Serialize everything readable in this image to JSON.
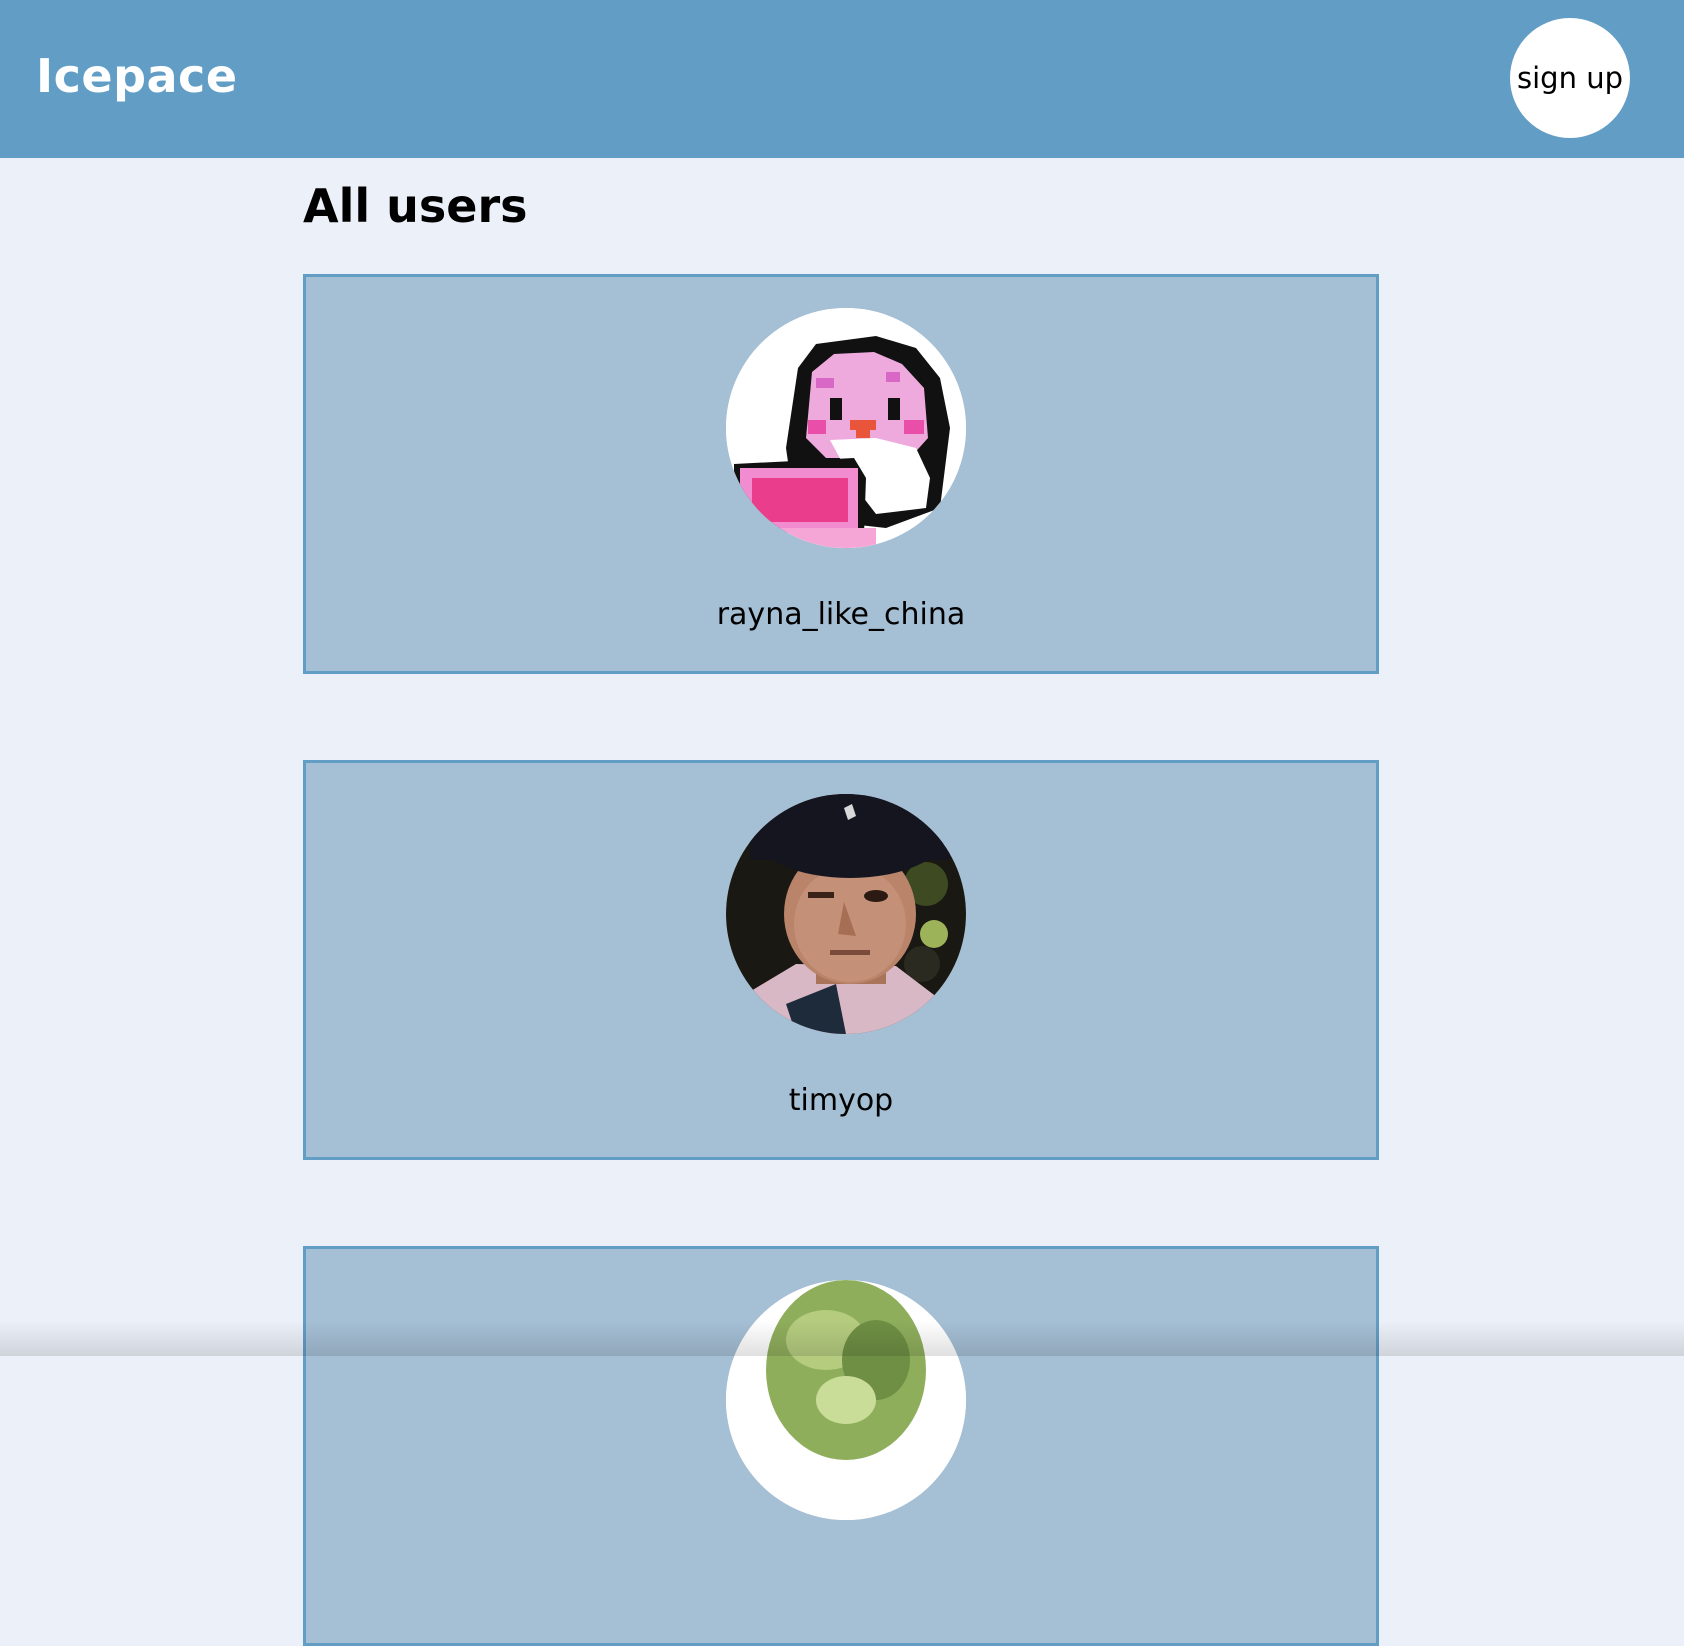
{
  "header": {
    "brand": "Icepace",
    "signup_label": "sign up"
  },
  "main": {
    "title": "All users",
    "users": [
      {
        "username": "rayna_like_china",
        "avatar_icon": "pixel-penguin-avatar"
      },
      {
        "username": "timyop",
        "avatar_icon": "man-winking-avatar"
      },
      {
        "username": "",
        "avatar_icon": "lettuce-avatar"
      }
    ]
  },
  "colors": {
    "header_bg": "#629dc5",
    "page_bg": "#ecf0f8",
    "card_bg": "#a5bfd5",
    "card_border": "#629dc5"
  }
}
